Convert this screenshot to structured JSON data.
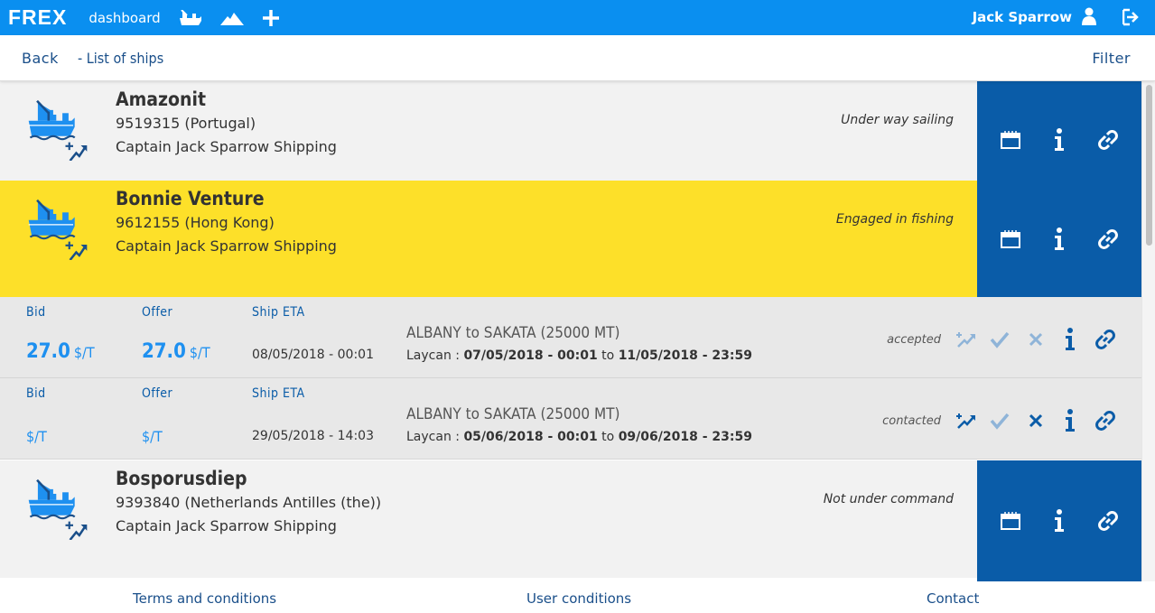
{
  "topbar": {
    "logo": "FREX",
    "dashboard": "dashboard",
    "user_name": "Jack Sparrow",
    "icons": [
      "ship-icon",
      "mountain-icon",
      "plus-icon",
      "user-icon",
      "logout-icon"
    ]
  },
  "subbar": {
    "back": "Back",
    "breadcrumb": "- List of ships",
    "filter": "Filter"
  },
  "ships": [
    {
      "name": "Amazonit",
      "imo": "9519315 (Portugal)",
      "company": "Captain Jack Sparrow Shipping",
      "status": "Under way sailing"
    },
    {
      "name": "Bonnie Venture",
      "imo": "9612155 (Hong Kong)",
      "company": "Captain Jack Sparrow Shipping",
      "status": "Engaged in fishing"
    },
    {
      "name": "Bosporusdiep",
      "imo": "9393840 (Netherlands Antilles (the))",
      "company": "Captain Jack Sparrow Shipping",
      "status": "Not under command"
    }
  ],
  "offers": [
    {
      "bid_label": "Bid",
      "offer_label": "Offer",
      "eta_label": "Ship ETA",
      "bid_value": "27.0",
      "offer_value": "27.0",
      "unit": "$/T",
      "eta": "08/05/2018 - 00:01",
      "route_from": "ALBANY",
      "route_to_word": "to",
      "route_to": "SAKATA",
      "route_qty": "(25000 MT)",
      "laycan_label": "Laycan :",
      "laycan_from": "07/05/2018 - 00:01",
      "laycan_to_word": "to",
      "laycan_to": "11/05/2018 - 23:59",
      "status": "accepted"
    },
    {
      "bid_label": "Bid",
      "offer_label": "Offer",
      "eta_label": "Ship ETA",
      "bid_value": "",
      "offer_value": "",
      "unit": "$/T",
      "eta": "29/05/2018 - 14:03",
      "route_from": "ALBANY",
      "route_to_word": "to",
      "route_to": "SAKATA",
      "route_qty": "(25000 MT)",
      "laycan_label": "Laycan :",
      "laycan_from": "05/06/2018 - 00:01",
      "laycan_to_word": "to",
      "laycan_to": "09/06/2018 - 23:59",
      "status": "contacted"
    }
  ],
  "footer": {
    "terms": "Terms and conditions",
    "user_conditions": "User conditions",
    "contact": "Contact"
  },
  "colors": {
    "topbar": "#0a8ff0",
    "actions_panel": "#0a5ca8",
    "selected_row": "#fde029",
    "row": "#f2f2f2",
    "offer_row": "#e8e8e8",
    "price": "#1e90f0"
  }
}
